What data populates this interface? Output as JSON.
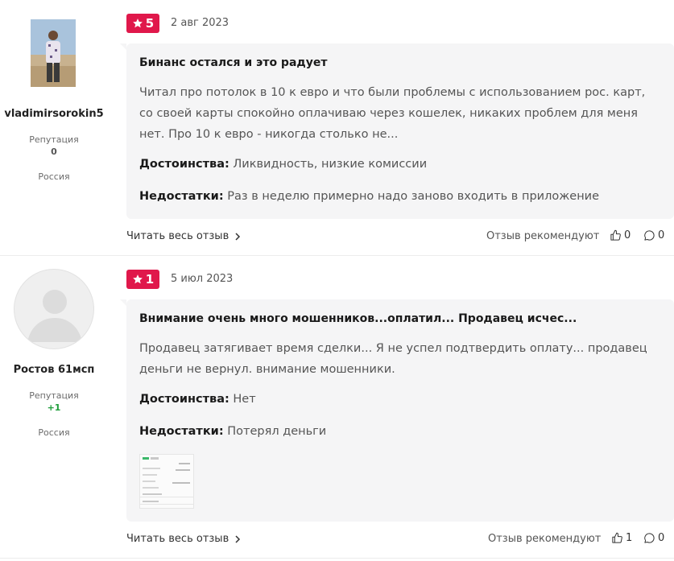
{
  "reviews": [
    {
      "author": {
        "name": "vladimirsorokin5",
        "reputation_label": "Репутация",
        "reputation_value": "0",
        "country": "Россия",
        "avatar": "user-photo"
      },
      "rating": "5",
      "date": "2 авг 2023",
      "title": "Бинанс остался и это радует",
      "body": "Читал про потолок в 10 к евро и что были проблемы с использованием рос. карт, со своей карты спокойно оплачиваю через кошелек, никаких проблем для меня нет. Про 10 к евро - никогда столько не...",
      "pros_label": "Достоинства:",
      "pros": "Ликвидность, низкие комиссии",
      "cons_label": "Недостатки:",
      "cons": "Раз в неделю примерно надо заново входить в приложение",
      "read_more": "Читать весь отзыв",
      "recommend_label": "Отзыв рекомендуют",
      "likes": "0",
      "comments": "0"
    },
    {
      "author": {
        "name": "Ростов 61мсп",
        "reputation_label": "Репутация",
        "reputation_value": "+1",
        "country": "Россия",
        "avatar": "default-user-avatar"
      },
      "rating": "1",
      "date": "5 июл 2023",
      "title": "Внимание очень много мошенников...оплатил... Продавец исчес...",
      "body": "Продавец затягивает время сделки... Я не успел подтвердить оплату... продавец деньги не вернул. внимание мошенники.",
      "pros_label": "Достоинства:",
      "pros": "Нет",
      "cons_label": "Недостатки:",
      "cons": "Потерял деньги",
      "read_more": "Читать весь отзыв",
      "recommend_label": "Отзыв рекомендуют",
      "likes": "1",
      "comments": "0"
    }
  ],
  "colors": {
    "badge": "#e0184b",
    "card_bg": "#f5f5f6",
    "positive_rep": "#1e9e3a"
  },
  "icons": [
    "star-icon",
    "chevron-right-icon",
    "thumbs-up-icon",
    "comment-icon"
  ]
}
